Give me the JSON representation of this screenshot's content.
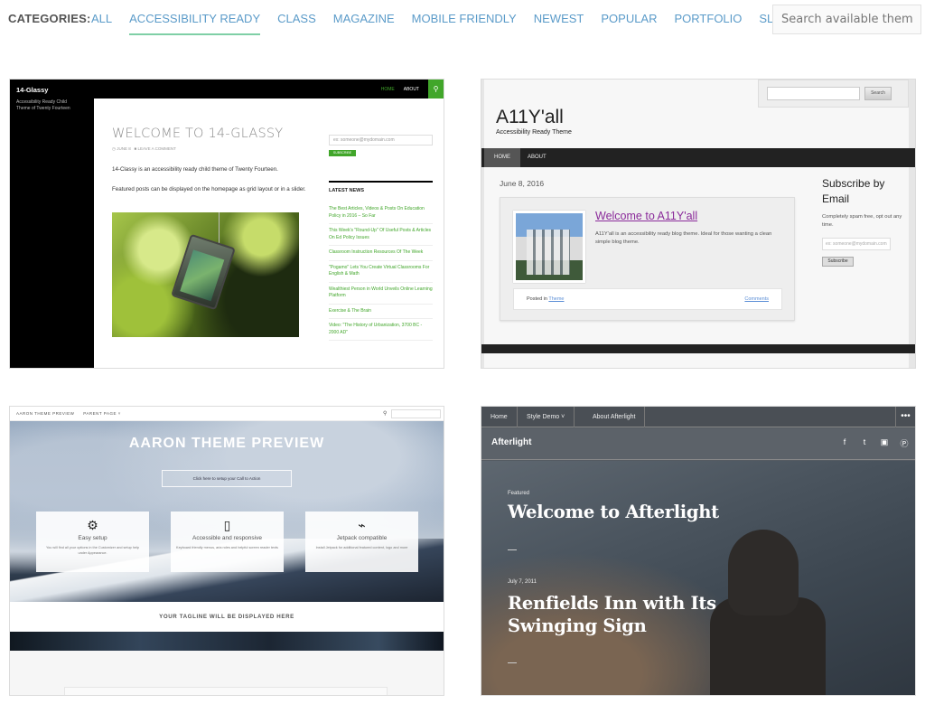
{
  "filter": {
    "label": "CATEGORIES:",
    "categories": [
      {
        "label": "ALL",
        "active": false
      },
      {
        "label": "ACCESSIBILITY READY",
        "active": true
      },
      {
        "label": "CLASS",
        "active": false
      },
      {
        "label": "MAGAZINE",
        "active": false
      },
      {
        "label": "MOBILE FRIENDLY",
        "active": false
      },
      {
        "label": "NEWEST",
        "active": false
      },
      {
        "label": "POPULAR",
        "active": false
      },
      {
        "label": "PORTFOLIO",
        "active": false
      },
      {
        "label": "SLIDER",
        "active": false
      }
    ],
    "search_placeholder": "Search available themes.",
    "accent_color": "#7fcfa6",
    "link_color": "#5b9bc9"
  },
  "themes": {
    "glassy": {
      "site_title": "14-Glassy",
      "site_desc": "Accessibility Ready Child Theme of Twenty Fourteen",
      "nav": [
        "HOME",
        "ABOUT"
      ],
      "search_icon": "search-icon",
      "post_title": "WELCOME TO 14-GLASSY",
      "post_date": "JUNE 8",
      "post_comment": "LEAVE A COMMENT",
      "para1": "14-Classy is an accessibility ready child theme of Twenty Fourteen.",
      "para2": "Featured posts can be displayed on the homepage as grid layout or in a slider.",
      "email_placeholder": "ex: someone@mydomain.com",
      "subscribe_label": "SUBSCRIBE",
      "news_heading": "LATEST NEWS",
      "news": [
        "The Best Articles, Videos & Posts On Education Policy in 2016 – So Far",
        "This Week's \"Round-Up\" Of Useful Posts & Articles On Ed Policy Issues",
        "Classroom Instruction Resources Of The Week",
        "\"Pogamo\" Lets You Create Virtual Classrooms For English & Math",
        "Wealthiest Person in World Unveils Online Learning Platform",
        "Exercise & The Brain",
        "Video: \"The History of Urbanization, 3700 BC - 2000 AD\""
      ],
      "accent_color": "#41a62a"
    },
    "ally": {
      "search_label": "Search",
      "site_title": "A11Y'all",
      "tagline": "Accessibility Ready Theme",
      "nav": [
        "HOME",
        "ABOUT"
      ],
      "date": "June 8, 2016",
      "post_title": "Welcome to A11Y'all",
      "post_text": "A11Y'all is an accessibility ready blog theme. Ideal for those wanting a clean simple blog theme.",
      "posted_in": "Posted in",
      "category": "Theme",
      "comments": "Comments",
      "subscribe_title": "Subscribe by Email",
      "subscribe_text": "Completely spam free, opt out any time.",
      "email_placeholder": "ex: someone@mydomain.com",
      "subscribe_label": "Subscribe"
    },
    "aaron": {
      "top_nav": [
        "AARON THEME PREVIEW",
        "PARENT PAGE ˅"
      ],
      "hero_title": "AARON THEME PREVIEW",
      "cta": "Click here to setup your Call to Action",
      "features": [
        {
          "icon": "gear-icon",
          "glyph": "⚙",
          "title": "Easy setup",
          "text": "You will find all your options in the Customizer and setup help under Appearance."
        },
        {
          "icon": "mobile-icon",
          "glyph": "▯",
          "title": "Accessible and responsive",
          "text": "Keyboard friendly menus, aria roles and helpful screen reader texts"
        },
        {
          "icon": "plug-icon",
          "glyph": "⌁",
          "title": "Jetpack compatible",
          "text": "Install Jetpack for additional featured content, logo and more"
        }
      ],
      "tagline": "YOUR TAGLINE WILL BE DISPLAYED HERE"
    },
    "afterlight": {
      "nav": [
        "Home",
        "Style Demo ˅",
        "About Afterlight"
      ],
      "more": "•••",
      "site_title": "Afterlight",
      "social": [
        {
          "icon": "facebook-icon",
          "glyph": "f"
        },
        {
          "icon": "twitter-icon",
          "glyph": "t"
        },
        {
          "icon": "instagram-icon",
          "glyph": "▣"
        },
        {
          "icon": "pinterest-icon",
          "glyph": "Ⓟ"
        }
      ],
      "featured_label": "Featured",
      "featured_title": "Welcome to Afterlight",
      "post_date": "July 7, 2011",
      "post_title": "Renfields Inn with Its Swinging Sign"
    }
  }
}
